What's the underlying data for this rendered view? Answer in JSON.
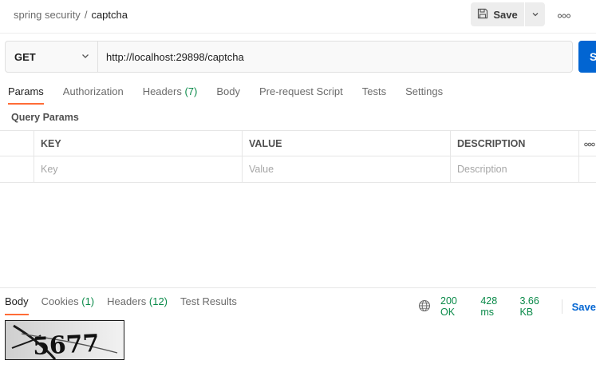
{
  "breadcrumb": {
    "parent": "spring security",
    "separator": "/",
    "current": "captcha"
  },
  "toolbar": {
    "save_label": "Save"
  },
  "request": {
    "method": "GET",
    "url": "http://localhost:29898/captcha",
    "send_label": "S"
  },
  "request_tabs": [
    {
      "label": "Params",
      "active": true
    },
    {
      "label": "Authorization"
    },
    {
      "label": "Headers",
      "count": "(7)"
    },
    {
      "label": "Body"
    },
    {
      "label": "Pre-request Script"
    },
    {
      "label": "Tests"
    },
    {
      "label": "Settings"
    }
  ],
  "query_params": {
    "title": "Query Params",
    "columns": [
      "KEY",
      "VALUE",
      "DESCRIPTION"
    ],
    "placeholders": [
      "Key",
      "Value",
      "Description"
    ]
  },
  "response": {
    "tabs": [
      {
        "label": "Body",
        "active": true
      },
      {
        "label": "Cookies",
        "count": "(1)"
      },
      {
        "label": "Headers",
        "count": "(12)"
      },
      {
        "label": "Test Results"
      }
    ],
    "status": "200 OK",
    "time": "428 ms",
    "size": "3.66 KB",
    "save_label": "Save"
  },
  "captcha_text": "5677",
  "colors": {
    "accent": "#ff6c37",
    "primary": "#0265d2",
    "success": "#0a8a49"
  },
  "icons": [
    "save-icon",
    "chevron-down-icon",
    "more-icon",
    "globe-icon"
  ]
}
